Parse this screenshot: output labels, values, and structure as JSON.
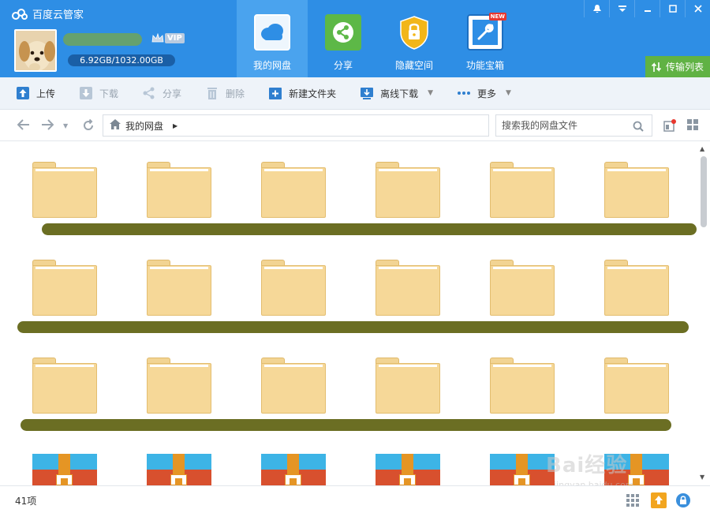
{
  "header": {
    "app_title": "百度云管家",
    "vip_label": "VIP",
    "quota": "6.92GB/1032.00GB",
    "tabs": [
      {
        "label": "我的网盘",
        "icon": "cloud-icon",
        "active": true
      },
      {
        "label": "分享",
        "icon": "share-icon",
        "active": false
      },
      {
        "label": "隐藏空间",
        "icon": "lock-shield-icon",
        "active": false
      },
      {
        "label": "功能宝箱",
        "icon": "wrench-icon",
        "active": false,
        "badge": "NEW"
      }
    ],
    "transfer_label": "传输列表",
    "colors": {
      "header_bg": "#2e8ee5",
      "active_tab": "#4aa3ee",
      "transfer_bg": "#60b244"
    }
  },
  "toolbar": {
    "upload": "上传",
    "download": "下载",
    "share": "分享",
    "delete": "删除",
    "new_folder": "新建文件夹",
    "offline_download": "离线下载",
    "more": "更多"
  },
  "addressbar": {
    "breadcrumb": "我的网盘",
    "search_placeholder": "搜索我的网盘文件"
  },
  "content": {
    "rows": [
      {
        "type": "folder",
        "count": 6
      },
      {
        "type": "folder",
        "count": 6
      },
      {
        "type": "folder",
        "count": 6
      },
      {
        "type": "archive",
        "count": 6
      }
    ]
  },
  "status": {
    "item_count": "41项"
  },
  "watermark": {
    "text": "Bai经验",
    "url": "jingyan.baidu.com"
  }
}
